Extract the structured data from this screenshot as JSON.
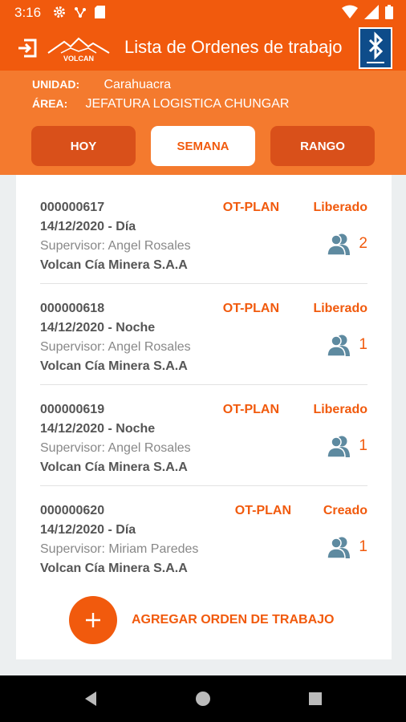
{
  "statusbar": {
    "time": "3:16"
  },
  "appbar": {
    "title": "Lista de Ordenes de trabajo",
    "logo_text": "VOLCAN"
  },
  "info": {
    "unit_label": "UNIDAD:",
    "unit_value": "Carahuacra",
    "area_label": "ÁREA:",
    "area_value": "JEFATURA LOGISTICA CHUNGAR"
  },
  "filters": {
    "today": "HOY",
    "week": "SEMANA",
    "range": "RANGO",
    "selected": "SEMANA"
  },
  "orders": [
    {
      "number": "000000617",
      "date": "14/12/2020 - Día",
      "supervisor": "Supervisor: Angel Rosales",
      "company": "Volcan Cía Minera S.A.A",
      "type": "OT-PLAN",
      "status": "Liberado",
      "count": "2"
    },
    {
      "number": "000000618",
      "date": "14/12/2020 - Noche",
      "supervisor": "Supervisor: Angel Rosales",
      "company": "Volcan Cía Minera S.A.A",
      "type": "OT-PLAN",
      "status": "Liberado",
      "count": "1"
    },
    {
      "number": "000000619",
      "date": "14/12/2020 - Noche",
      "supervisor": "Supervisor: Angel Rosales",
      "company": "Volcan Cía Minera S.A.A",
      "type": "OT-PLAN",
      "status": "Liberado",
      "count": "1"
    },
    {
      "number": "000000620",
      "date": "14/12/2020 - Día",
      "supervisor": "Supervisor: Miriam Paredes",
      "company": "Volcan Cía Minera S.A.A",
      "type": "OT-PLAN",
      "status": "Creado",
      "count": "1"
    }
  ],
  "add_button": {
    "label": "AGREGAR ORDEN DE TRABAJO"
  },
  "icons": {
    "status_left": [
      "gear-icon",
      "usb-icon",
      "sd-card-icon"
    ],
    "status_right": [
      "wifi-icon",
      "signal-icon",
      "battery-icon"
    ],
    "appbar": [
      "exit-icon",
      "bluetooth-icon"
    ],
    "order_people": "people-icon",
    "add": "plus-icon",
    "nav": [
      "back-icon",
      "home-icon",
      "recents-icon"
    ]
  },
  "colors": {
    "primary": "#f15a0d",
    "panel": "#f47a2e",
    "segment_inactive": "#d9501a",
    "people_icon": "#5e8aa0",
    "bluetooth_bg": "#0e4c8a"
  }
}
